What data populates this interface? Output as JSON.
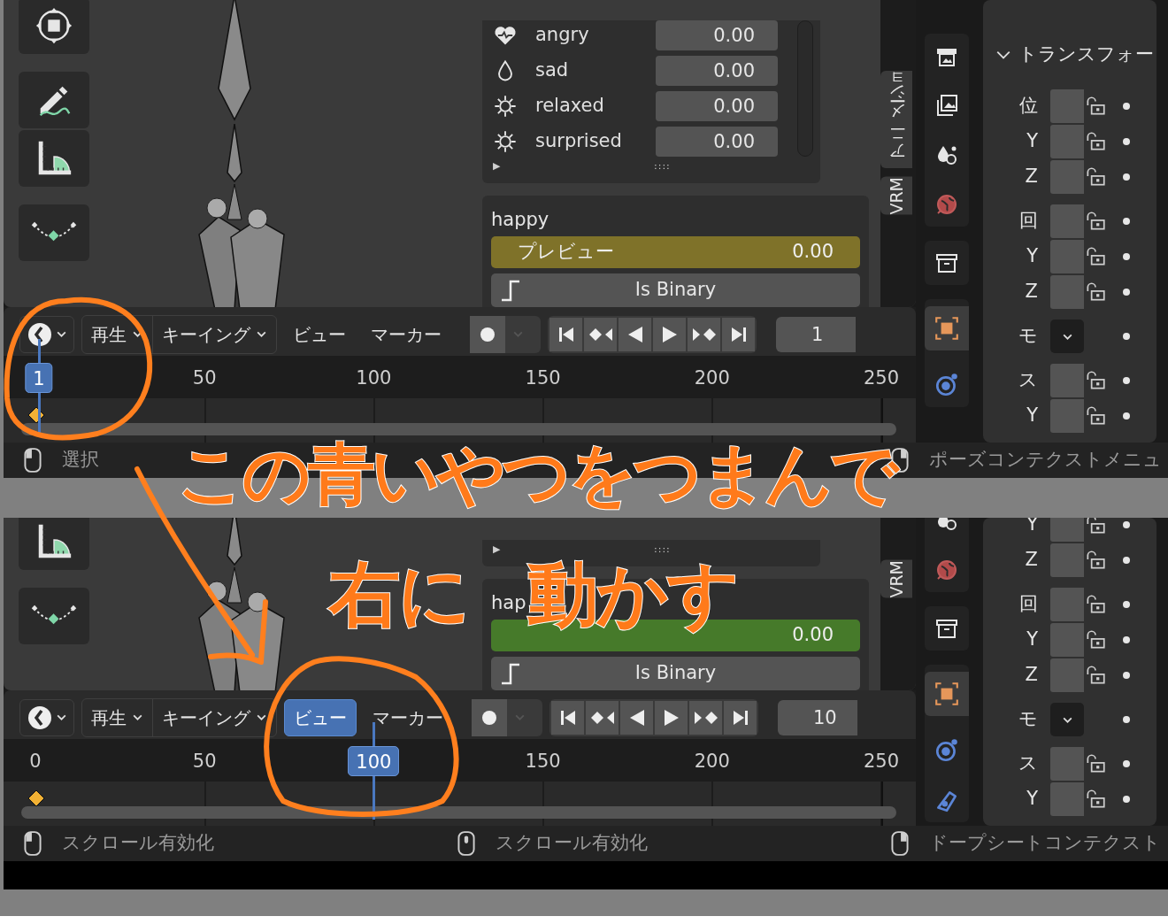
{
  "panels": [
    {
      "tools": [
        {
          "kind": "transform"
        },
        {
          "kind": "annotate"
        },
        {
          "kind": "measure"
        },
        {
          "kind": "curve"
        }
      ],
      "shape_keys": [
        {
          "name": "angry",
          "kind": "heart",
          "value": "0.00"
        },
        {
          "name": "sad",
          "kind": "drop",
          "value": "0.00"
        },
        {
          "name": "relaxed",
          "kind": "sun",
          "value": "0.00"
        },
        {
          "name": "surprised",
          "kind": "sun",
          "value": "0.00"
        }
      ],
      "list_expand": "▶",
      "list_grip": "::::",
      "shape_key": {
        "name": "happy",
        "preview_label": "プレビュー",
        "preview_value": "0.00",
        "keyframed": false,
        "binary_label": "Is Binary"
      },
      "sidebar_tabs": [
        {
          "label": "アニメーショ"
        },
        {
          "label": "VRM"
        }
      ],
      "timeline": {
        "menus": [
          {
            "label": "再生",
            "dropdown": true,
            "selected": false
          },
          {
            "label": "キーイング",
            "dropdown": true,
            "selected": false
          },
          {
            "label": "ビュー",
            "dropdown": false,
            "selected": false
          },
          {
            "label": "マーカー",
            "dropdown": false,
            "selected": false
          }
        ],
        "frame_field": "1",
        "ticks": [
          {
            "label": "50",
            "level": 0.2
          },
          {
            "label": "100",
            "level": 0.4
          },
          {
            "label": "150",
            "level": 0.6
          },
          {
            "label": "200",
            "level": 0.8
          },
          {
            "label": "250",
            "level": 1
          }
        ],
        "playhead": {
          "label": "1",
          "level": 0.004
        }
      },
      "properties": {
        "tab_groups": [
          [
            {
              "kind": "output",
              "selected": false
            },
            {
              "kind": "view_layer",
              "selected": false
            },
            {
              "kind": "scene",
              "selected": false
            },
            {
              "kind": "world",
              "selected": false
            }
          ],
          [
            {
              "kind": "collection",
              "selected": false
            }
          ],
          [
            {
              "kind": "object",
              "selected": true
            },
            {
              "kind": "physics",
              "selected": false
            }
          ]
        ],
        "section": "トランスフォー",
        "groups": [
          [
            {
              "label": "位",
              "kind": "lock"
            },
            {
              "label": "Y",
              "kind": "lock"
            },
            {
              "label": "Z",
              "kind": "lock"
            }
          ],
          [
            {
              "label": "回",
              "kind": "lock"
            },
            {
              "label": "Y",
              "kind": "lock"
            },
            {
              "label": "Z",
              "kind": "lock"
            }
          ],
          [
            {
              "label": "モ",
              "kind": "dropdown"
            }
          ],
          [
            {
              "label": "ス",
              "kind": "lock"
            },
            {
              "label": "Y",
              "kind": "lock"
            }
          ]
        ]
      },
      "status_bar": [
        {
          "kind": "left",
          "text": "選択"
        },
        {
          "kind": "none"
        },
        {
          "kind": "right",
          "text": "ポーズコンテクストメニュ"
        }
      ]
    },
    {
      "tools": [
        {
          "kind": "measure"
        },
        {
          "kind": "curve"
        }
      ],
      "list_expand": "▶",
      "list_grip": "::::",
      "shape_key": {
        "name": "hap",
        "preview_value": "0.00",
        "keyframed": true,
        "binary_label": "Is Binary"
      },
      "sidebar_tabs": [
        {
          "label": "VRM"
        }
      ],
      "timeline": {
        "menus": [
          {
            "label": "再生",
            "dropdown": true,
            "selected": false
          },
          {
            "label": "キーイング",
            "dropdown": true,
            "selected": false
          },
          {
            "label": "ビュー",
            "dropdown": false,
            "selected": true
          },
          {
            "label": "マーカー",
            "dropdown": false,
            "selected": false
          }
        ],
        "frame_field": "10",
        "ticks": [
          {
            "label": "0",
            "level": 0
          },
          {
            "label": "50",
            "level": 0.2
          },
          {
            "label": "150",
            "level": 0.6
          },
          {
            "label": "200",
            "level": 0.8
          },
          {
            "label": "250",
            "level": 1
          }
        ],
        "playhead": {
          "label": "100",
          "level": 0.4
        }
      },
      "properties": {
        "tab_groups": [
          [
            {
              "kind": "scene",
              "selected": false
            },
            {
              "kind": "world",
              "selected": false
            }
          ],
          [
            {
              "kind": "collection",
              "selected": false
            }
          ],
          [
            {
              "kind": "object",
              "selected": true
            },
            {
              "kind": "physics",
              "selected": false
            },
            {
              "kind": "bone",
              "selected": false
            }
          ]
        ],
        "groups": [
          [
            {
              "label": "Y",
              "kind": "lock"
            },
            {
              "label": "Z",
              "kind": "lock"
            }
          ],
          [
            {
              "label": "回",
              "kind": "lock"
            },
            {
              "label": "Y",
              "kind": "lock"
            },
            {
              "label": "Z",
              "kind": "lock"
            }
          ],
          [
            {
              "label": "モ",
              "kind": "dropdown"
            }
          ],
          [
            {
              "label": "ス",
              "kind": "lock"
            },
            {
              "label": "Y",
              "kind": "lock"
            }
          ]
        ]
      },
      "status_bar": [
        {
          "kind": "left",
          "text": "スクロール有効化"
        },
        {
          "kind": "middle",
          "text": "スクロール有効化"
        },
        {
          "kind": "right",
          "text": "ドープシートコンテクスト"
        }
      ]
    }
  ],
  "annotations": [
    {
      "text": "この青いやつをつまんで"
    },
    {
      "text": "右に"
    },
    {
      "text": "動かす"
    }
  ]
}
